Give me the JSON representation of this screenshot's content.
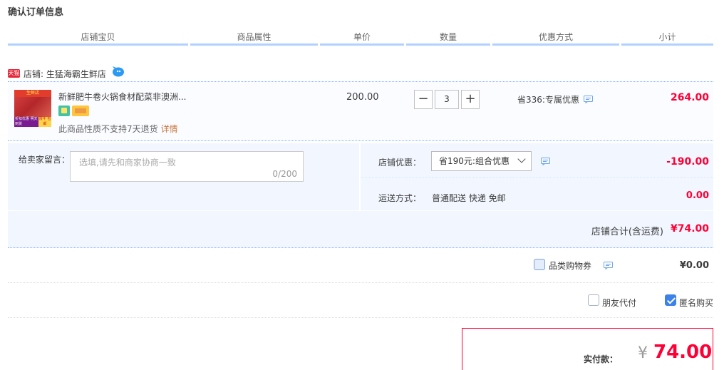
{
  "page": {
    "title": "确认订单信息"
  },
  "table_header": [
    "店铺宝贝",
    "商品属性",
    "单价",
    "数量",
    "优惠方式",
    "小计"
  ],
  "shop": {
    "badge": "天猫",
    "label": "店铺: 生猛海霸生鲜店"
  },
  "item": {
    "name": "新鲜肥牛卷火锅食材配菜非澳洲...",
    "thumb_top": "生鲜店",
    "thumb_bl": "折扣优惠 明天到货",
    "thumb_br": "限牛 包邮",
    "no_return": "此商品性质不支持7天退货",
    "detail_link": "详情",
    "unit_price": "200.00",
    "quantity": "3",
    "minus": "−",
    "plus": "+",
    "promo": "省336:专属优惠",
    "subtotal": "264.00"
  },
  "message": {
    "label": "给卖家留言：",
    "placeholder": "选填,请先和商家协商一致",
    "count": "0/200"
  },
  "shop_discount": {
    "label": "店铺优惠：",
    "selected": "省190元:组合优惠",
    "amount": "-190.00"
  },
  "shipping": {
    "label": "运送方式：",
    "value": "普通配送 快递 免邮",
    "amount": "0.00"
  },
  "shop_total": {
    "label": "店铺合计(含运费)",
    "amount": "¥74.00"
  },
  "coupon": {
    "label": "品类购物券",
    "amount": "¥0.00"
  },
  "options": {
    "friend_pay": "朋友代付",
    "anonymous": "匿名购买"
  },
  "payment": {
    "label": "实付款：",
    "currency": "¥",
    "amount": "74.00"
  },
  "colors": {
    "accent_red": "#ff0036",
    "header_line": "#b2d1ff",
    "panel_bg": "#f2f7ff"
  }
}
